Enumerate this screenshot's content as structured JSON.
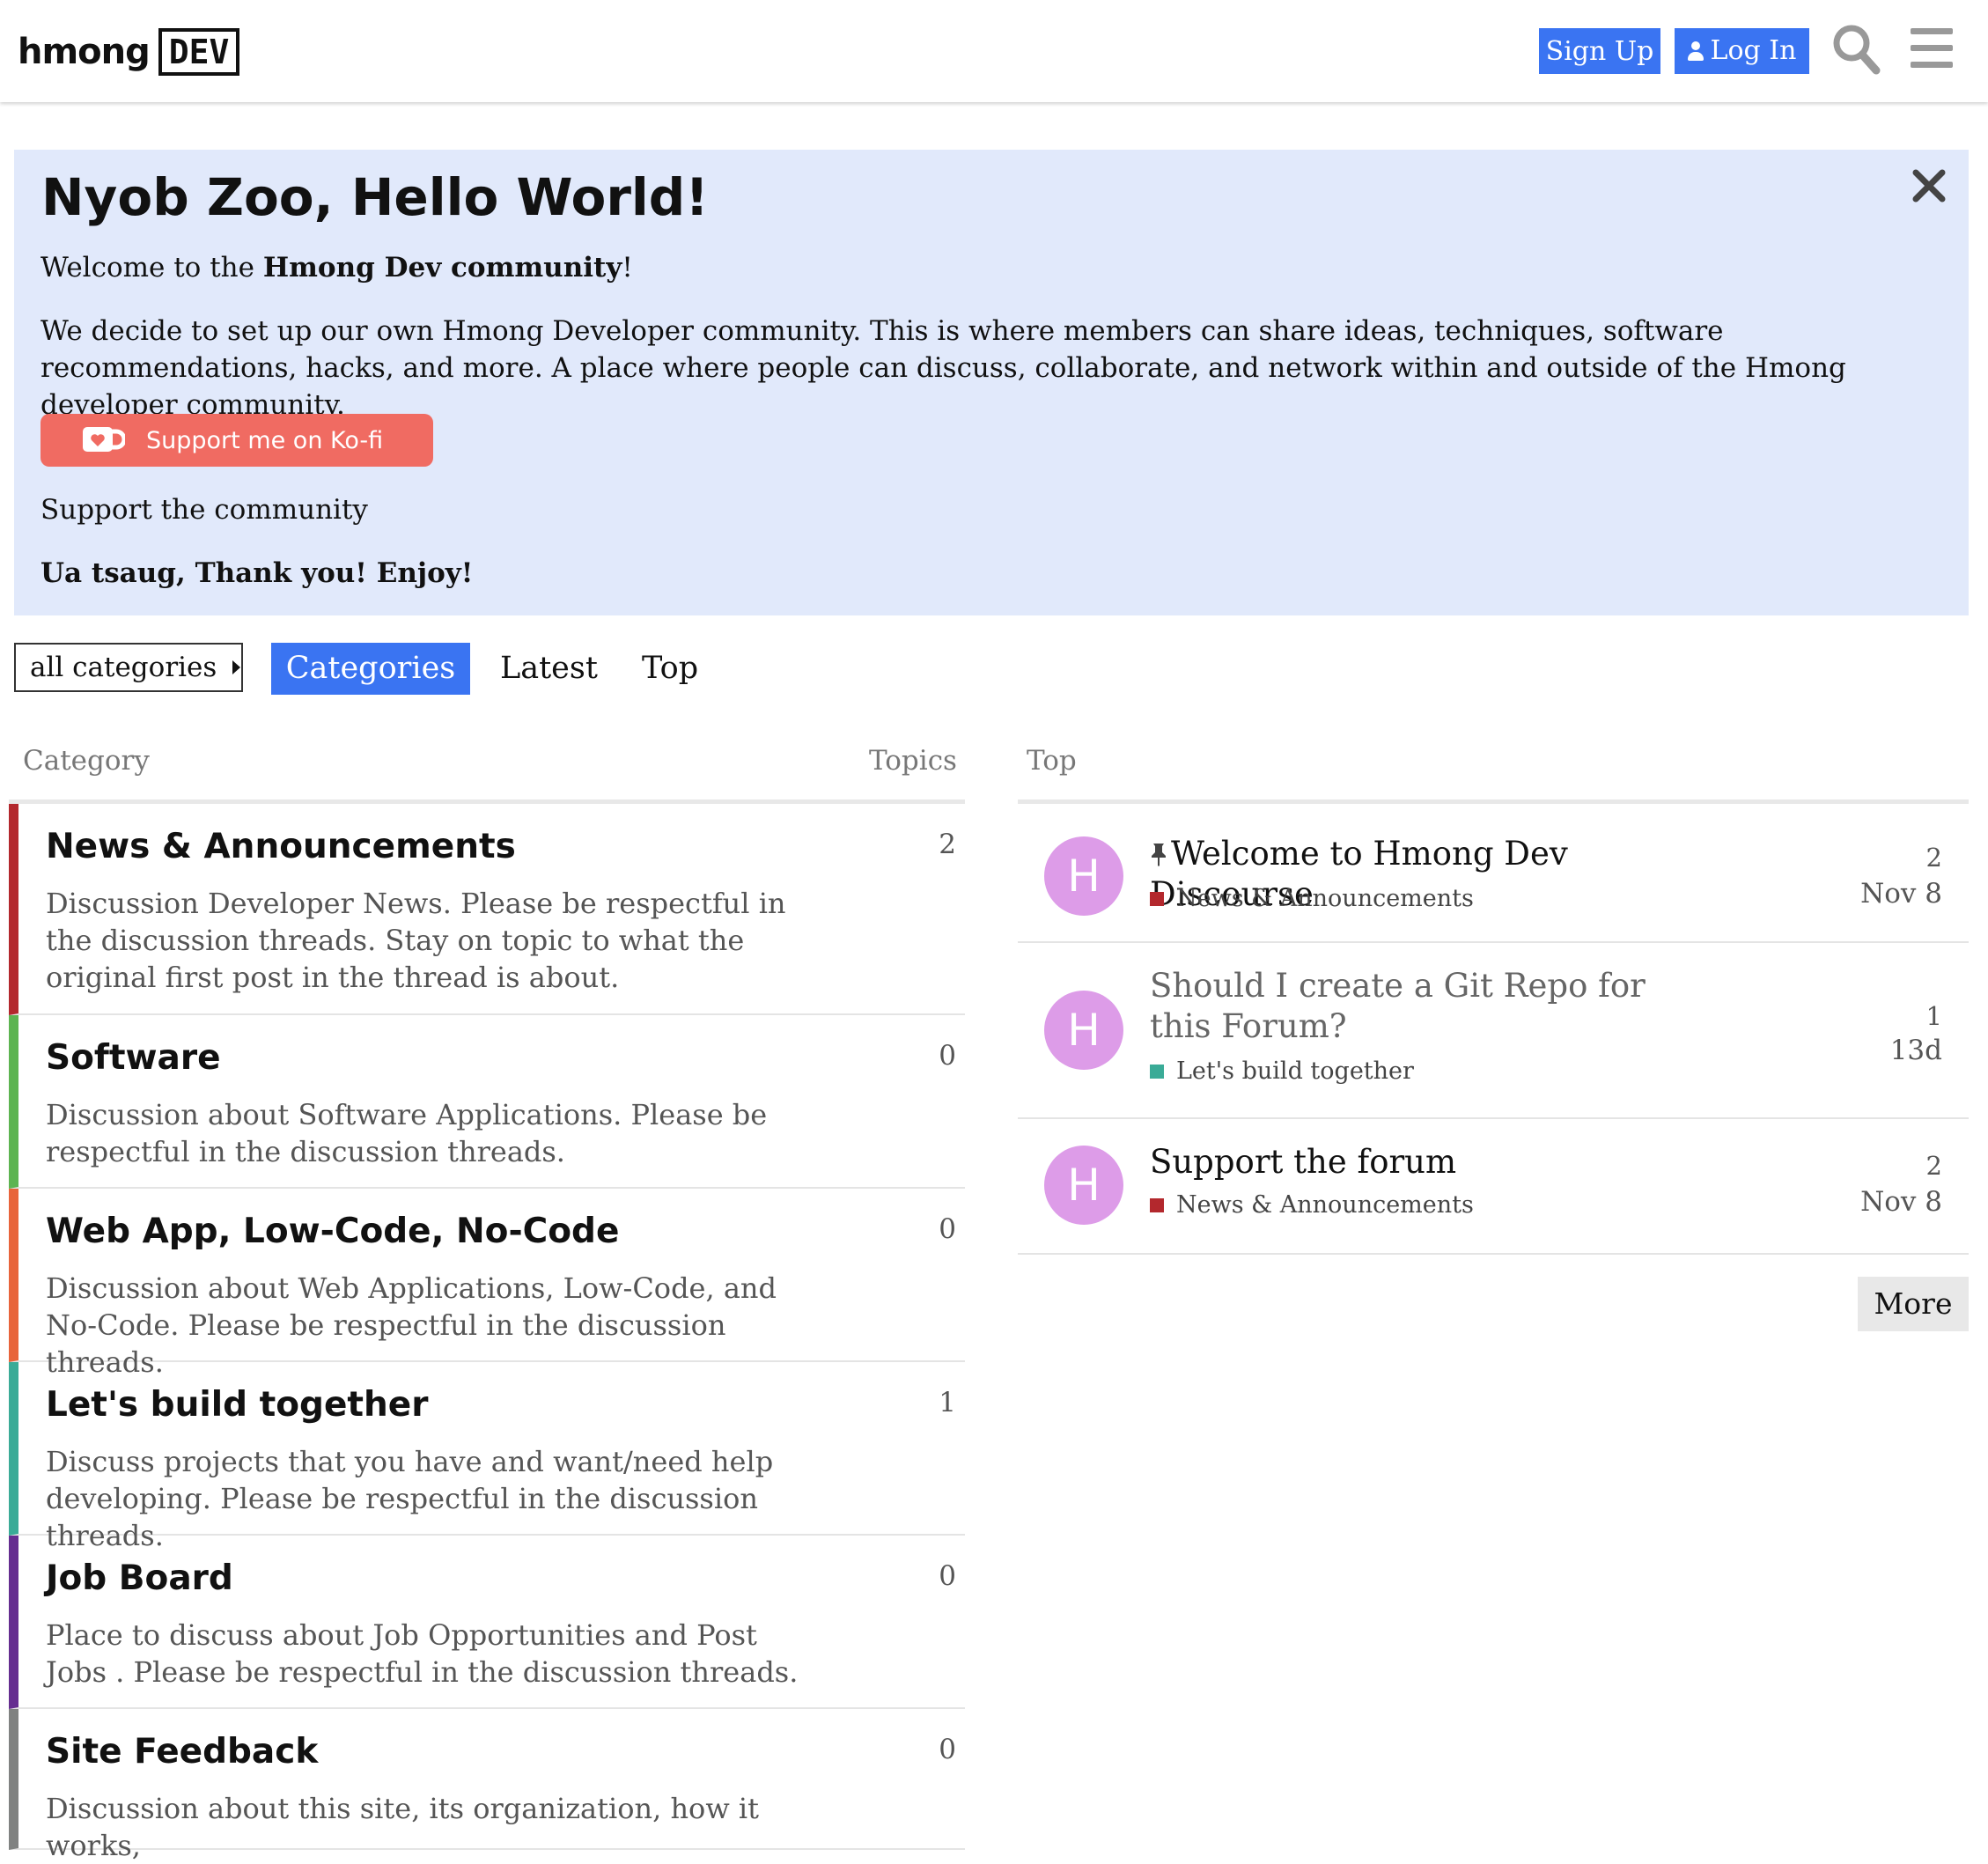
{
  "header": {
    "logo_text": "hmong",
    "logo_box": "DEV",
    "signup_label": "Sign Up",
    "login_label": "Log In",
    "search_icon": "search-icon",
    "menu_icon": "hamburger-menu-icon"
  },
  "banner": {
    "title": "Nyob Zoo, Hello World!",
    "welcome_prefix": "Welcome to the ",
    "welcome_bold": "Hmong Dev community",
    "welcome_suffix": "!",
    "description": "We decide to set up our own Hmong Developer community. This is where members can share ideas, techniques, software recommendations, hacks, and more. A place where people can discuss, collaborate, and network within and outside of the Hmong developer community.",
    "kofi_label": "Support me on Ko-fi",
    "support_link": "Support the community",
    "thanks": "Ua tsaug, Thank you! Enjoy!",
    "close_icon": "close-icon"
  },
  "nav": {
    "dropdown_label": "all categories",
    "tabs": [
      "Categories",
      "Latest",
      "Top"
    ],
    "active_tab": "Categories"
  },
  "categories": {
    "col_category": "Category",
    "col_topics": "Topics",
    "items": [
      {
        "name": "News & Announcements",
        "description": "Discussion Developer News. Please be respectful in the discussion threads. Stay on topic to what the original first post in the thread is about.",
        "topics": "2",
        "color": "#b3282d"
      },
      {
        "name": "Software",
        "description": "Discussion about Software Applications. Please be respectful in the discussion threads.",
        "topics": "0",
        "color": "#5db451"
      },
      {
        "name": "Web App, Low-Code, No-Code",
        "description": "Discussion about Web Applications, Low-Code, and No-Code. Please be respectful in the discussion threads.",
        "topics": "0",
        "color": "#e8643a"
      },
      {
        "name": "Let's build together",
        "description": "Discuss projects that you have and want/need help developing. Please be respectful in the discussion threads.",
        "topics": "1",
        "color": "#3aab97"
      },
      {
        "name": "Job Board",
        "description": "Place to discuss about Job Opportunities and Post Jobs . Please be respectful in the discussion threads.",
        "topics": "0",
        "color": "#652d90"
      },
      {
        "name": "Site Feedback",
        "description": "Discussion about this site, its organization, how it works,",
        "topics": "0",
        "color": "#808281"
      }
    ]
  },
  "top": {
    "col_header": "Top",
    "more_label": "More",
    "topics": [
      {
        "avatar": "H",
        "title": "Welcome to Hmong Dev Discourse",
        "pinned": true,
        "category": "News & Announcements",
        "category_color": "#b3282d",
        "replies": "2",
        "age": "Nov 8",
        "visited": false
      },
      {
        "avatar": "H",
        "title": "Should I create a Git Repo for this Forum?",
        "pinned": false,
        "category": "Let's build together",
        "category_color": "#3aab97",
        "replies": "1",
        "age": "13d",
        "visited": true
      },
      {
        "avatar": "H",
        "title": "Support the forum",
        "pinned": false,
        "category": "News & Announcements",
        "category_color": "#b3282d",
        "replies": "2",
        "age": "Nov 8",
        "visited": false
      }
    ]
  }
}
